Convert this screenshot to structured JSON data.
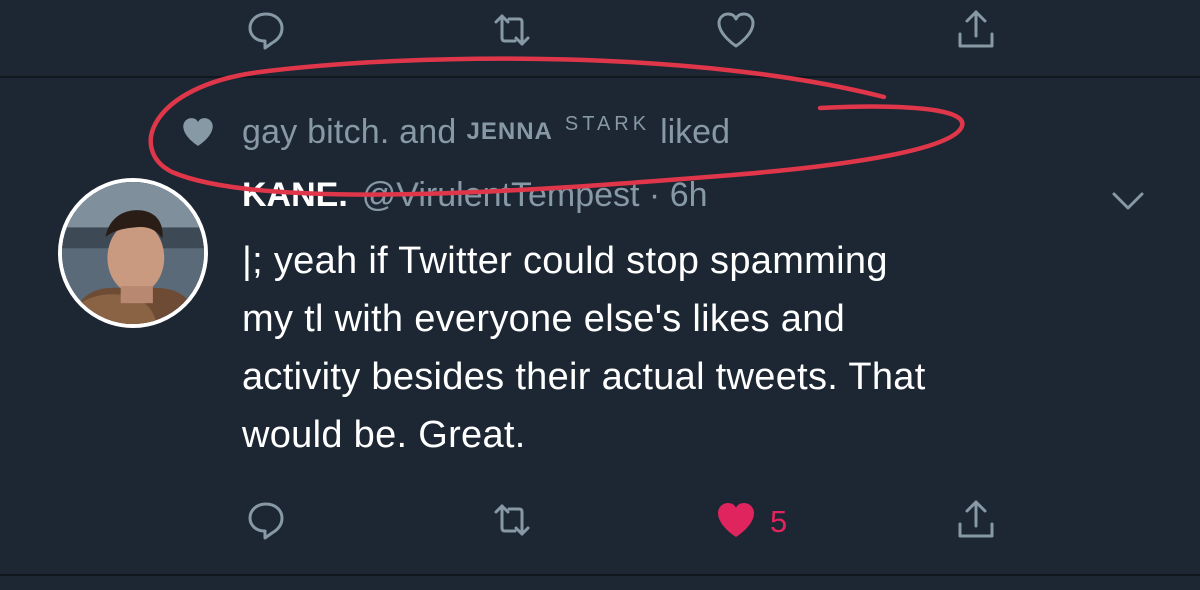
{
  "social_context": {
    "prefix": "gay bitch. and",
    "caps_name": "JENNA",
    "stark": "STARK",
    "suffix": "liked"
  },
  "tweet": {
    "display_name": "KANE.",
    "handle_time": "@VirulentTempest · 6h",
    "text_lines": [
      "|; yeah if Twitter could stop spamming",
      "my tl with everyone else's likes and",
      "activity besides their actual tweets. That",
      "would be. Great."
    ],
    "like_count": "5"
  },
  "colors": {
    "background": "#1c2733",
    "muted": "#8899a6",
    "like_active": "#e0245e",
    "annotation": "#e0364a"
  },
  "icons": {
    "reply": "reply-icon",
    "retweet": "retweet-icon",
    "like": "heart-icon",
    "share": "share-icon",
    "chevron": "chevron-down-icon"
  }
}
